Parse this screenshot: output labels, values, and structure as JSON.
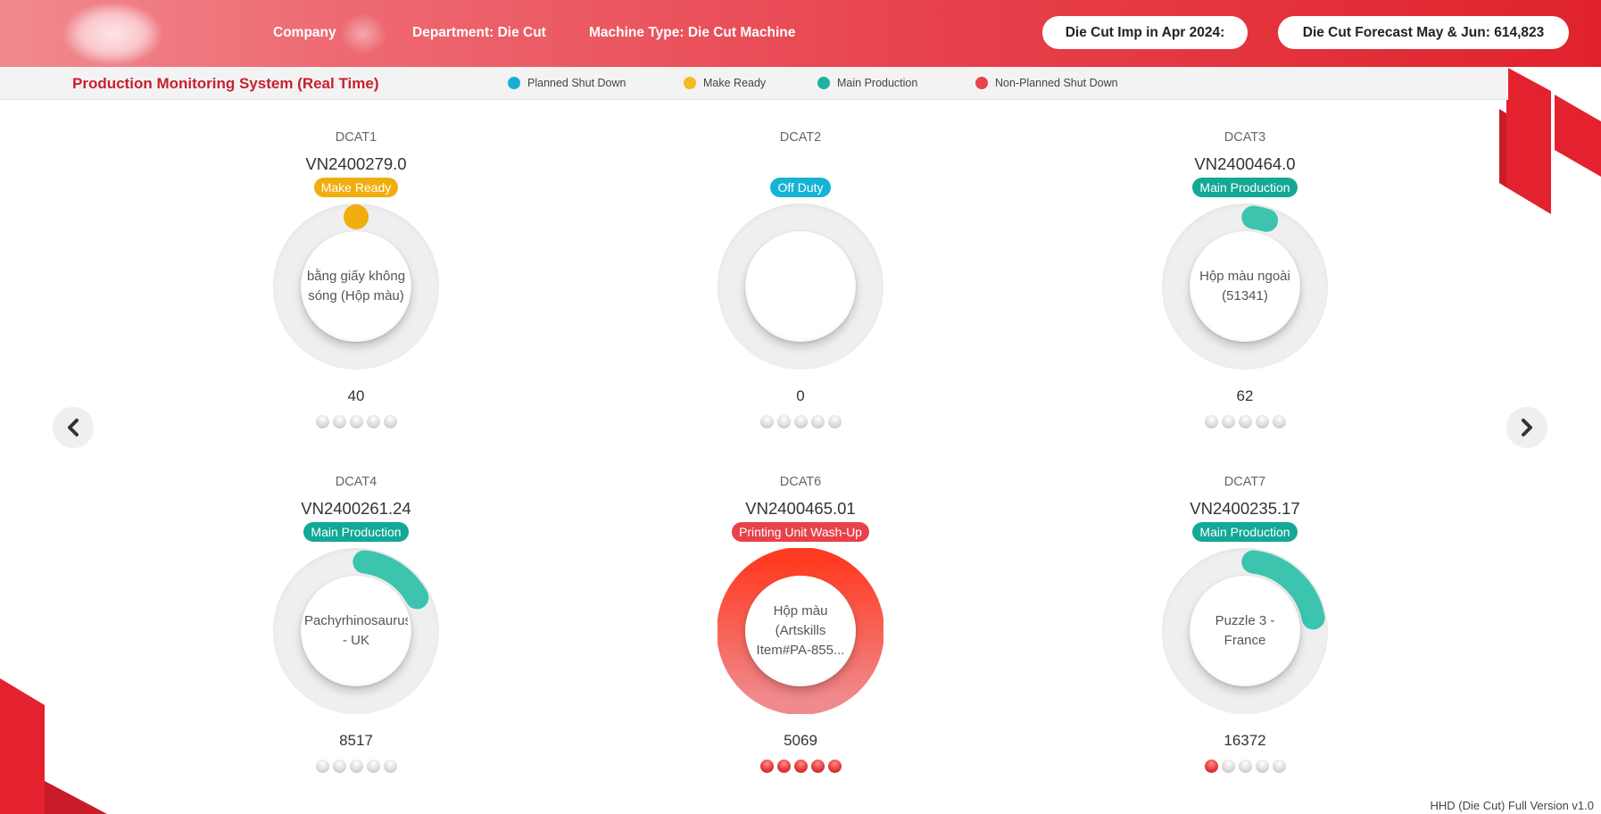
{
  "header": {
    "company_label": "Company",
    "department": "Department: Die Cut",
    "machine_type": "Machine Type: Die Cut Machine",
    "imp_pill": "Die Cut Imp in Apr 2024:",
    "forecast_pill": "Die Cut Forecast May & Jun: 614,823"
  },
  "subbar": {
    "title": "Production Monitoring System (Real Time)",
    "legend": [
      {
        "label": "Planned Shut Down",
        "color": "#1aaed4"
      },
      {
        "label": "Make Ready",
        "color": "#f2bd1d"
      },
      {
        "label": "Main Production",
        "color": "#1fb3a0"
      },
      {
        "label": "Non-Planned Shut Down",
        "color": "#e8434a"
      }
    ]
  },
  "colors": {
    "make_ready": "#f0ad0e",
    "off_duty": "#16b3d6",
    "main_production": "#14a896",
    "wash_up": "#e8414a",
    "ring_teal": "#3cc4ae",
    "ring_orange": "#f0ad0e"
  },
  "machines": [
    {
      "name": "DCAT1",
      "job": "VN2400279.0",
      "status": "Make Ready",
      "status_color": "#f0ad0e",
      "product": "bằng giấy không sóng (Hộp màu)",
      "count": "40",
      "progress": 0.02,
      "ring_color": "#f0ad0e",
      "ring_mode": "dot",
      "dots": [
        "grey",
        "grey",
        "grey",
        "grey",
        "grey"
      ]
    },
    {
      "name": "DCAT2",
      "job": "",
      "status": "Off Duty",
      "status_color": "#16b3d6",
      "product": "",
      "count": "0",
      "progress": 0,
      "ring_color": "#16b3d6",
      "ring_mode": "none",
      "dots": [
        "grey",
        "grey",
        "grey",
        "grey",
        "grey"
      ]
    },
    {
      "name": "DCAT3",
      "job": "VN2400464.0",
      "status": "Main Production",
      "status_color": "#14a896",
      "product": "Hộp màu ngoài (51341)",
      "count": "62",
      "progress": 0.05,
      "ring_color": "#3cc4ae",
      "ring_mode": "arc",
      "dots": [
        "grey",
        "grey",
        "grey",
        "grey",
        "grey"
      ]
    },
    {
      "name": "DCAT4",
      "job": "VN2400261.24",
      "status": "Main Production",
      "status_color": "#14a896",
      "product": "Pachyrhinosaurus - UK",
      "count": "8517",
      "progress": 0.17,
      "ring_color": "#3cc4ae",
      "ring_mode": "arc",
      "dots": [
        "grey",
        "grey",
        "grey",
        "grey",
        "grey"
      ]
    },
    {
      "name": "DCAT6",
      "job": "VN2400465.01",
      "status": "Printing Unit Wash-Up",
      "status_color": "#e8414a",
      "product": "Hộp màu (Artskills Item#PA-855...",
      "count": "5069",
      "progress": 1,
      "ring_color": "#f0524a",
      "ring_mode": "full",
      "dots": [
        "red",
        "red",
        "red",
        "red",
        "red"
      ]
    },
    {
      "name": "DCAT7",
      "job": "VN2400235.17",
      "status": "Main Production",
      "status_color": "#14a896",
      "product": "Puzzle 3 - France",
      "count": "16372",
      "progress": 0.22,
      "ring_color": "#3cc4ae",
      "ring_mode": "arc",
      "dots": [
        "red",
        "grey",
        "grey",
        "grey",
        "grey"
      ]
    }
  ],
  "footer": {
    "version": "HHD (Die Cut) Full Version v1.0"
  }
}
